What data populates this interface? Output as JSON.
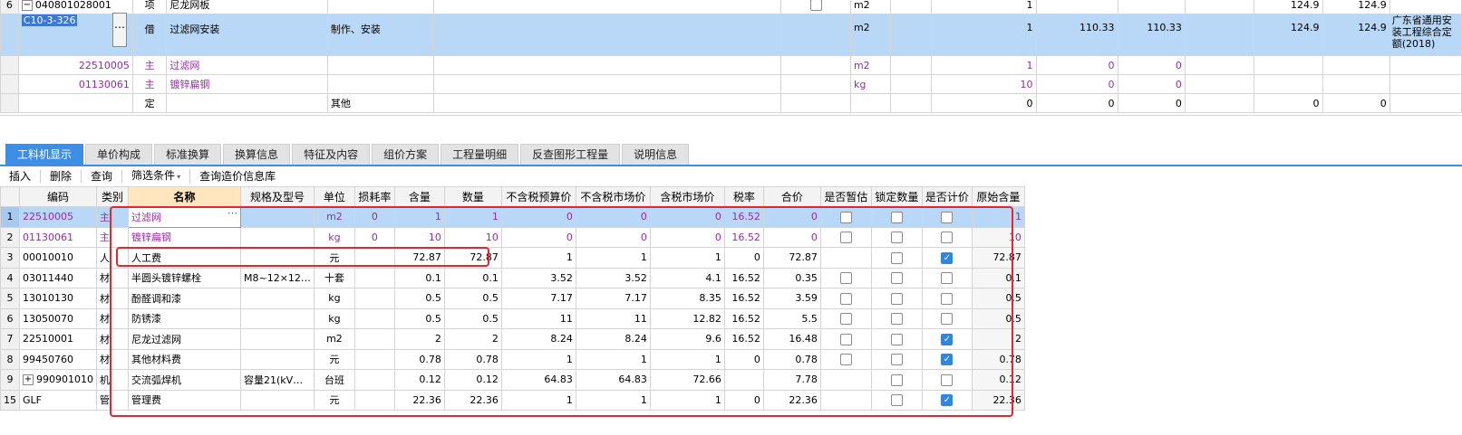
{
  "top_table": {
    "rows": [
      {
        "rownum": "6",
        "code": "040801028001",
        "type": "项",
        "name": "尼龙网板",
        "work": "",
        "spec": "",
        "unit": "m2",
        "qty": "1",
        "c1": "",
        "c2": "",
        "c3": "124.9",
        "c4": "124.9",
        "book": ""
      },
      {
        "rownum": "",
        "code": "C10-3-326",
        "type": "借",
        "name": "过滤网安装",
        "work": "制作、安装",
        "spec": "",
        "unit": "m2",
        "qty": "1",
        "c1": "110.33",
        "c2": "110.33",
        "c3": "124.9",
        "c4": "124.9",
        "book": "广东省通用安装工程综合定额(2018)"
      },
      {
        "rownum": "",
        "code": "22510005",
        "type": "主",
        "name": "过滤网",
        "work": "",
        "spec": "",
        "unit": "m2",
        "qty": "1",
        "c1": "0",
        "c2": "0",
        "c3": "",
        "c4": "",
        "book": ""
      },
      {
        "rownum": "",
        "code": "01130061",
        "type": "主",
        "name": "镀锌扁钢",
        "work": "",
        "spec": "",
        "unit": "kg",
        "qty": "10",
        "c1": "0",
        "c2": "0",
        "c3": "",
        "c4": "",
        "book": ""
      },
      {
        "rownum": "",
        "code": "",
        "type": "定",
        "name": "",
        "work": "其他",
        "spec": "",
        "unit": "",
        "qty": "0",
        "c1": "0",
        "c2": "0",
        "c3": "0",
        "c4": "0",
        "book": ""
      }
    ]
  },
  "tabs": [
    "工料机显示",
    "单价构成",
    "标准换算",
    "换算信息",
    "特征及内容",
    "组价方案",
    "工程量明细",
    "反查图形工程量",
    "说明信息"
  ],
  "toolbar": [
    "插入",
    "删除",
    "查询",
    "筛选条件",
    "查询造价信息库"
  ],
  "toolbar_dropdown_icon": "caret-down-icon",
  "grid": {
    "headers": [
      "",
      "编码",
      "类别",
      "名称",
      "规格及型号",
      "单位",
      "损耗率",
      "含量",
      "数量",
      "不含税预算价",
      "不含税市场价",
      "含税市场价",
      "税率",
      "合价",
      "是否暂估",
      "锁定数量",
      "是否计价",
      "原始含量"
    ],
    "rows": [
      {
        "no": "1",
        "code": "22510005",
        "cat": "主",
        "name": "过滤网",
        "spec": "",
        "unit": "m2",
        "loss": "0",
        "content": "1",
        "qty": "1",
        "p1": "0",
        "p2": "0",
        "p3": "0",
        "tax": "16.52",
        "total": "0",
        "est": false,
        "lock": false,
        "price": false,
        "orig": "1",
        "purple": true,
        "expand": false
      },
      {
        "no": "2",
        "code": "01130061",
        "cat": "主",
        "name": "镀锌扁钢",
        "spec": "",
        "unit": "kg",
        "loss": "0",
        "content": "10",
        "qty": "10",
        "p1": "0",
        "p2": "0",
        "p3": "0",
        "tax": "16.52",
        "total": "0",
        "est": false,
        "lock": false,
        "price": false,
        "orig": "10",
        "purple": true,
        "expand": false
      },
      {
        "no": "3",
        "code": "00010010",
        "cat": "人",
        "name": "人工费",
        "spec": "",
        "unit": "元",
        "loss": "",
        "content": "72.87",
        "qty": "72.87",
        "p1": "1",
        "p2": "1",
        "p3": "1",
        "tax": "0",
        "total": "72.87",
        "est": null,
        "lock": false,
        "price": true,
        "orig": "72.87",
        "purple": false,
        "expand": false
      },
      {
        "no": "4",
        "code": "03011440",
        "cat": "材",
        "name": "半圆头镀锌螺栓",
        "spec": "M8~12×12…",
        "unit": "十套",
        "loss": "",
        "content": "0.1",
        "qty": "0.1",
        "p1": "3.52",
        "p2": "3.52",
        "p3": "4.1",
        "tax": "16.52",
        "total": "0.35",
        "est": false,
        "lock": false,
        "price": false,
        "orig": "0.1",
        "purple": false,
        "expand": false
      },
      {
        "no": "5",
        "code": "13010130",
        "cat": "材",
        "name": "酚醛调和漆",
        "spec": "",
        "unit": "kg",
        "loss": "",
        "content": "0.5",
        "qty": "0.5",
        "p1": "7.17",
        "p2": "7.17",
        "p3": "8.35",
        "tax": "16.52",
        "total": "3.59",
        "est": false,
        "lock": false,
        "price": false,
        "orig": "0.5",
        "purple": false,
        "expand": false
      },
      {
        "no": "6",
        "code": "13050070",
        "cat": "材",
        "name": "防锈漆",
        "spec": "",
        "unit": "kg",
        "loss": "",
        "content": "0.5",
        "qty": "0.5",
        "p1": "11",
        "p2": "11",
        "p3": "12.82",
        "tax": "16.52",
        "total": "5.5",
        "est": false,
        "lock": false,
        "price": false,
        "orig": "0.5",
        "purple": false,
        "expand": false
      },
      {
        "no": "7",
        "code": "22510001",
        "cat": "材",
        "name": "尼龙过滤网",
        "spec": "",
        "unit": "m2",
        "loss": "",
        "content": "2",
        "qty": "2",
        "p1": "8.24",
        "p2": "8.24",
        "p3": "9.6",
        "tax": "16.52",
        "total": "16.48",
        "est": false,
        "lock": false,
        "price": true,
        "orig": "2",
        "purple": false,
        "expand": false
      },
      {
        "no": "8",
        "code": "99450760",
        "cat": "材",
        "name": "其他材料费",
        "spec": "",
        "unit": "元",
        "loss": "",
        "content": "0.78",
        "qty": "0.78",
        "p1": "1",
        "p2": "1",
        "p3": "1",
        "tax": "0",
        "total": "0.78",
        "est": false,
        "lock": false,
        "price": true,
        "orig": "0.78",
        "purple": false,
        "expand": false
      },
      {
        "no": "9",
        "code": "990901010",
        "cat": "机",
        "name": "交流弧焊机",
        "spec": "容量21(kV…",
        "unit": "台班",
        "loss": "",
        "content": "0.12",
        "qty": "0.12",
        "p1": "64.83",
        "p2": "64.83",
        "p3": "72.66",
        "tax": "",
        "total": "7.78",
        "est": null,
        "lock": false,
        "price": false,
        "orig": "0.12",
        "purple": false,
        "expand": true
      },
      {
        "no": "15",
        "code": "GLF",
        "cat": "管",
        "name": "管理费",
        "spec": "",
        "unit": "元",
        "loss": "",
        "content": "22.36",
        "qty": "22.36",
        "p1": "1",
        "p2": "1",
        "p3": "1",
        "tax": "0",
        "total": "22.36",
        "est": null,
        "lock": false,
        "price": true,
        "orig": "22.36",
        "purple": false,
        "expand": false
      }
    ]
  },
  "colors": {
    "selection": "#b9d7f7",
    "tab_active": "#3d8ee6",
    "purple_text": "#9a2aa8",
    "annotation_red": "#e8262a",
    "checkbox_on": "#2f86e0"
  }
}
